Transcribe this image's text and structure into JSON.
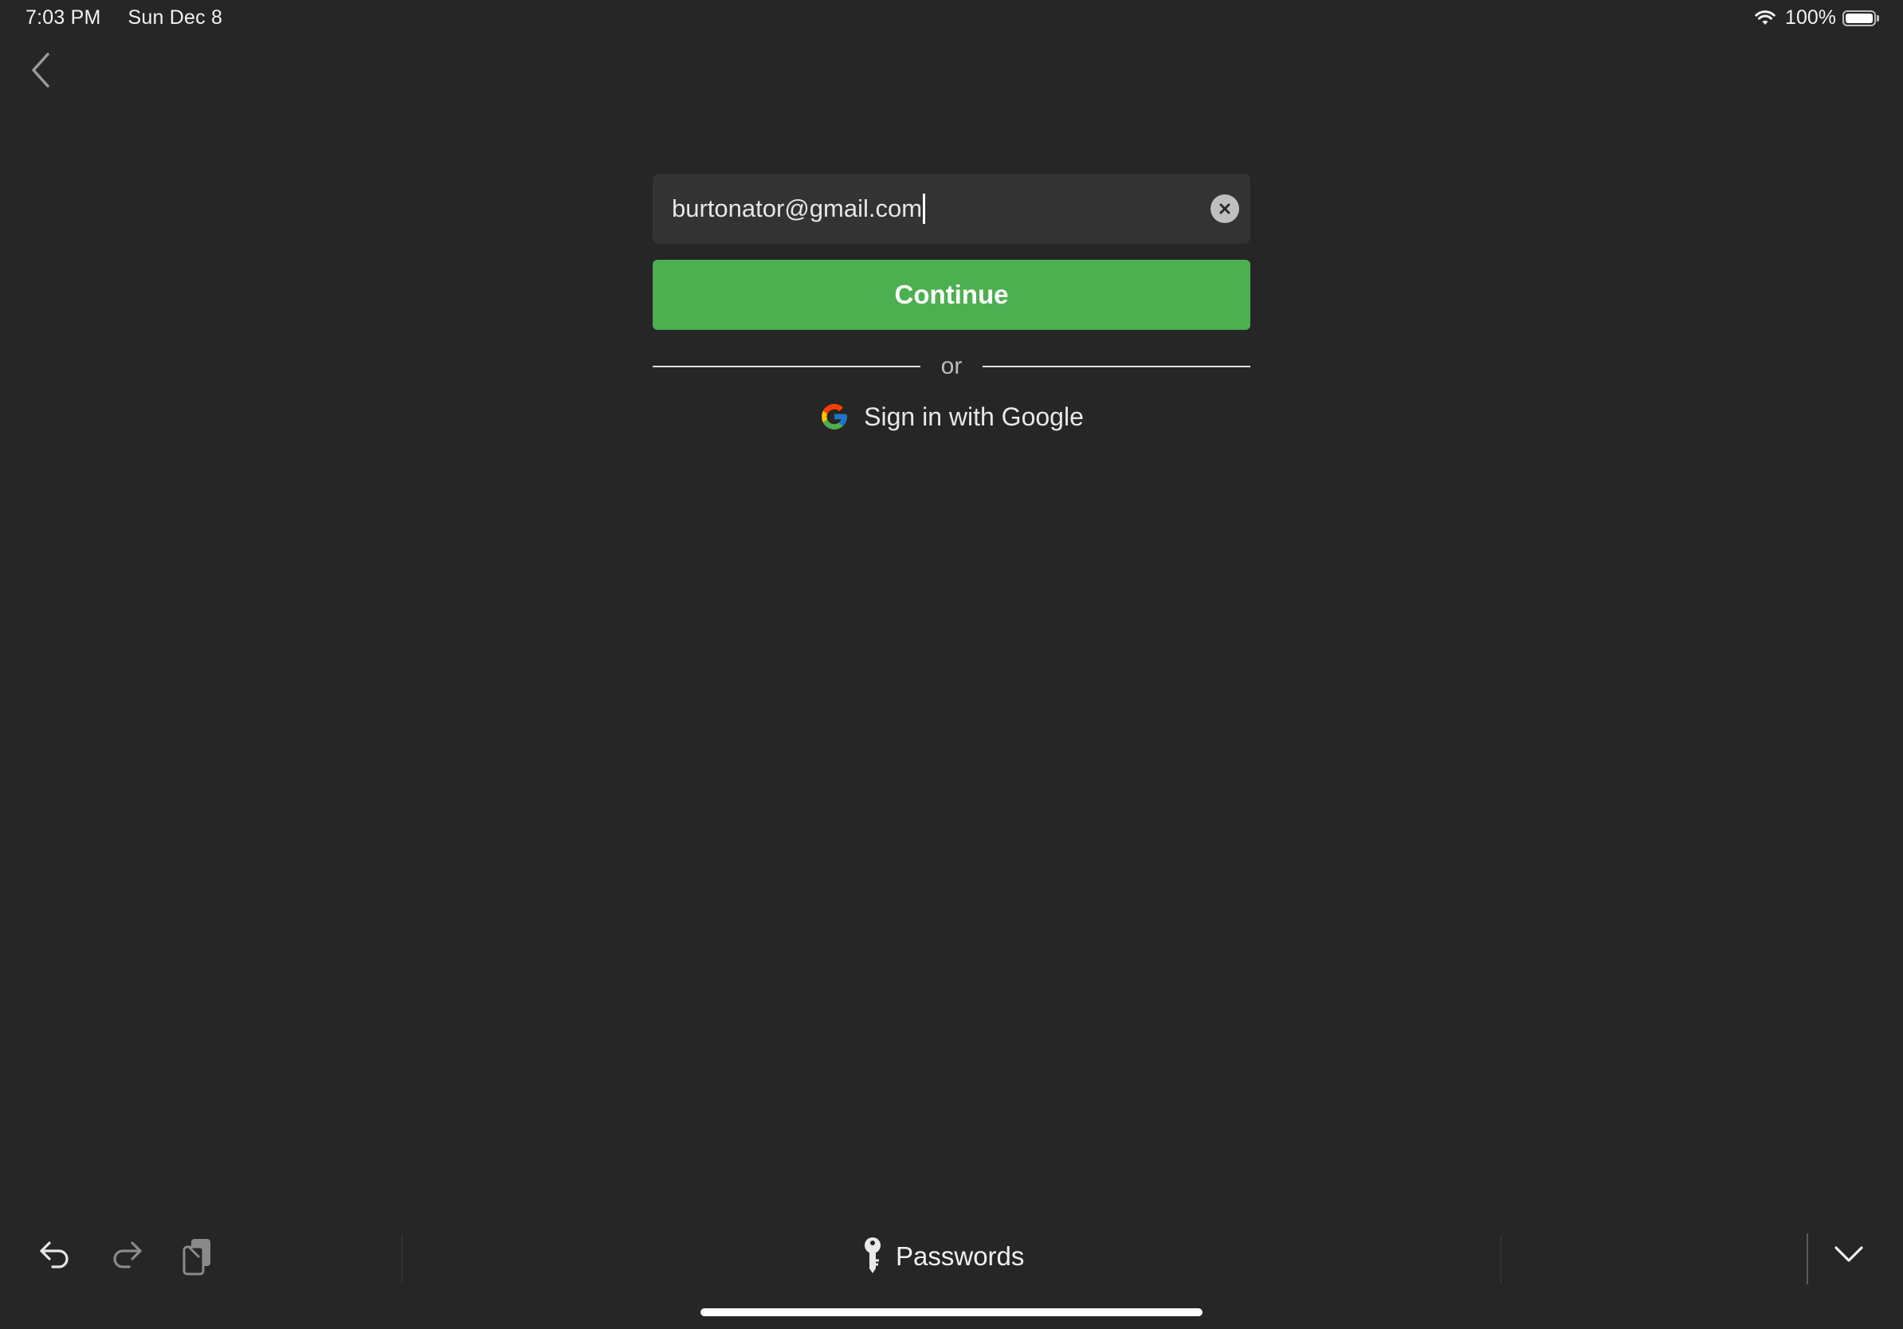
{
  "status_bar": {
    "time": "7:03 PM",
    "date": "Sun Dec 8",
    "battery_percent": "100%",
    "battery_level": 1.0
  },
  "nav": {
    "back_icon": "chevron-left-icon"
  },
  "form": {
    "email_value": "burtonator@gmail.com",
    "clear_icon": "clear-x-icon",
    "continue_label": "Continue",
    "or_label": "or",
    "google_label": "Sign in with Google",
    "google_icon": "google-g-icon"
  },
  "toolbar": {
    "undo_icon": "undo-icon",
    "redo_icon": "redo-icon",
    "paste_icon": "clipboard-icon",
    "passwords_label": "Passwords",
    "key_icon": "key-icon",
    "dismiss_icon": "chevron-down-icon"
  },
  "colors": {
    "background": "#262626",
    "field_background": "#333333",
    "accent_green": "#4caf50",
    "text": "#e6e6e6"
  }
}
